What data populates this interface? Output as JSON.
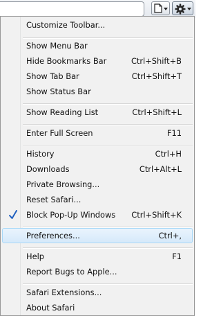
{
  "menu": {
    "items": [
      {
        "label": "Customize Toolbar...",
        "shortcut": ""
      },
      {
        "label": "Show Menu Bar",
        "shortcut": ""
      },
      {
        "label": "Hide Bookmarks Bar",
        "shortcut": "Ctrl+Shift+B"
      },
      {
        "label": "Show Tab Bar",
        "shortcut": "Ctrl+Shift+T"
      },
      {
        "label": "Show Status Bar",
        "shortcut": ""
      },
      {
        "label": "Show Reading List",
        "shortcut": "Ctrl+Shift+L"
      },
      {
        "label": "Enter Full Screen",
        "shortcut": "F11"
      },
      {
        "label": "History",
        "shortcut": "Ctrl+H"
      },
      {
        "label": "Downloads",
        "shortcut": "Ctrl+Alt+L"
      },
      {
        "label": "Private Browsing...",
        "shortcut": ""
      },
      {
        "label": "Reset Safari...",
        "shortcut": ""
      },
      {
        "label": "Block Pop-Up Windows",
        "shortcut": "Ctrl+Shift+K",
        "checked": true
      },
      {
        "label": "Preferences...",
        "shortcut": "Ctrl+,",
        "highlighted": true
      },
      {
        "label": "Help",
        "shortcut": "F1"
      },
      {
        "label": "Report Bugs to Apple...",
        "shortcut": ""
      },
      {
        "label": "Safari Extensions...",
        "shortcut": ""
      },
      {
        "label": "About Safari",
        "shortcut": ""
      }
    ]
  },
  "toolbar": {
    "page_menu_icon": "page-icon",
    "settings_menu_icon": "gear-icon"
  },
  "colors": {
    "highlight": "#d6e9fa",
    "highlight_border": "#a8d8f7",
    "check": "#1f5fbf"
  }
}
